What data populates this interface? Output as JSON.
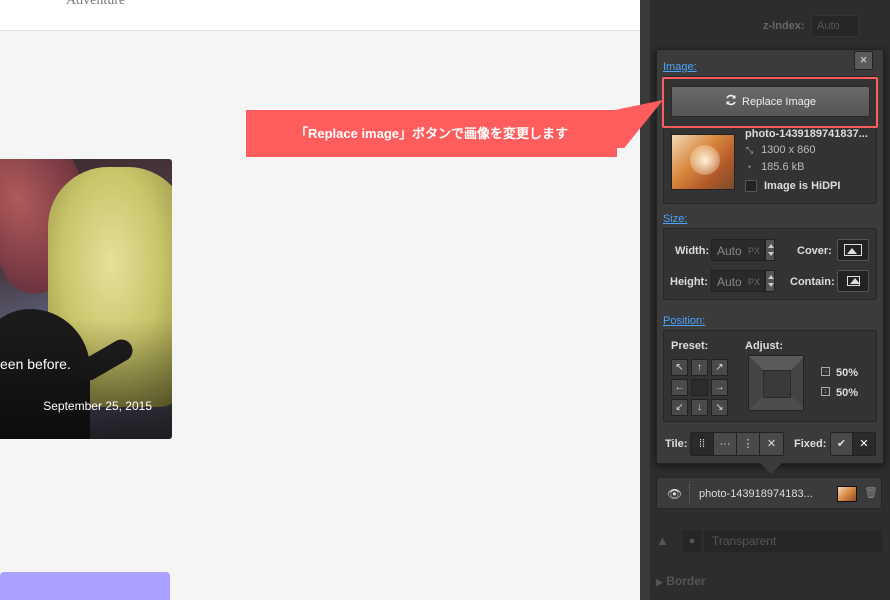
{
  "canvas": {
    "nav_text": "Adventure",
    "card": {
      "excerpt": "een before.",
      "date": "September 25, 2015"
    }
  },
  "sidebar": {
    "zindex_label": "z-Index:",
    "zindex_value": "Auto",
    "close_glyph": "×",
    "image": {
      "section_label": "Image:",
      "replace_button_label": "Replace Image",
      "file_name": "photo-1439189741837...",
      "dimensions": "1300 x 860",
      "file_size": "185.6 kB",
      "hidpi_label": "Image is HiDPI",
      "hidpi_checked": false
    },
    "size": {
      "section_label": "Size:",
      "width_label": "Width:",
      "width_value": "Auto",
      "height_label": "Height:",
      "height_value": "Auto",
      "unit": "PX",
      "cover_label": "Cover:",
      "contain_label": "Contain:"
    },
    "position": {
      "section_label": "Position:",
      "preset_label": "Preset:",
      "adjust_label": "Adjust:",
      "x_percent": "50%",
      "y_percent": "50%",
      "preset_grid": [
        "↖",
        "↑",
        "↗",
        "←",
        "",
        "→",
        "↙",
        "↓",
        "↘"
      ]
    },
    "tile": {
      "label": "Tile:",
      "options": [
        "⁞⁞",
        "···",
        "⋮",
        "✕"
      ]
    },
    "fixed": {
      "label": "Fixed:",
      "options": [
        "✔",
        "✕"
      ]
    },
    "layer": {
      "name": "photo-143918974183..."
    },
    "background": {
      "color_value": "Transparent"
    },
    "border": {
      "label": "Border"
    }
  },
  "callout": {
    "text": "「Replace image」ボタンで画像を変更します",
    "color": "#ff5d5d"
  },
  "colors": {
    "panel_bg": "#2d2d2d",
    "popup_bg": "#3b3b3b",
    "link_blue": "#4aa3ff",
    "highlight_red": "#ff5d5d"
  }
}
